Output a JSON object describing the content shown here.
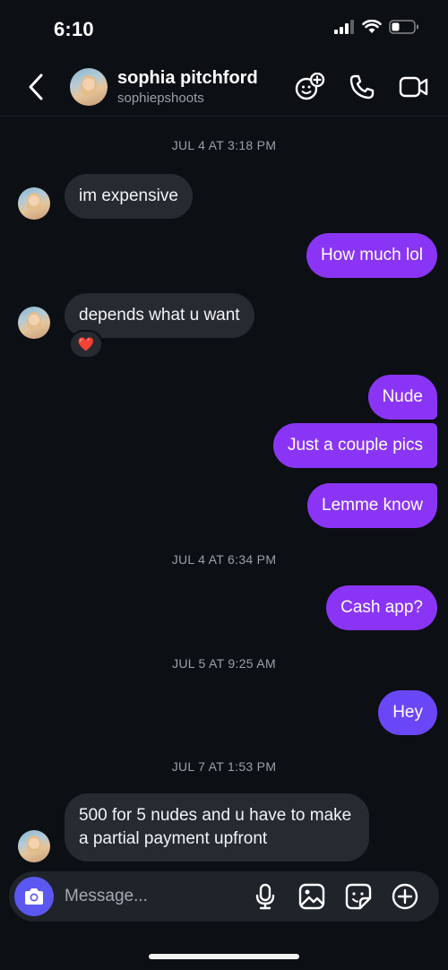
{
  "status_bar": {
    "time": "6:10"
  },
  "header": {
    "name": "sophia pitchford",
    "handle": "sophiepshoots"
  },
  "messages": {
    "ts1": "JUL 4 AT 3:18 PM",
    "m1": "im expensive",
    "m2": "How much lol",
    "m3": "depends what u want",
    "m3_reaction": "❤️",
    "m4": "Nude",
    "m5": "Just a couple pics",
    "m6": "Lemme know",
    "ts2": "JUL 4 AT 6:34 PM",
    "m7": "Cash app?",
    "ts3": "JUL 5 AT 9:25 AM",
    "m8": "Hey",
    "ts4": "JUL 7 AT 1:53 PM",
    "m9_line1": "500 for 5 nudes and u have to make",
    "m9_line2": "a partial payment upfront"
  },
  "composer": {
    "placeholder": "Message..."
  },
  "colors": {
    "sent": "#8a35f6",
    "sent_latest": "#6a47f6",
    "received": "#262a31",
    "background": "#0c0f14"
  },
  "icons": [
    "signal-icon",
    "wifi-icon",
    "battery-icon",
    "back-icon",
    "add-effect-icon",
    "phone-icon",
    "video-icon",
    "camera-icon",
    "microphone-icon",
    "gallery-icon",
    "sticker-icon",
    "plus-icon"
  ]
}
